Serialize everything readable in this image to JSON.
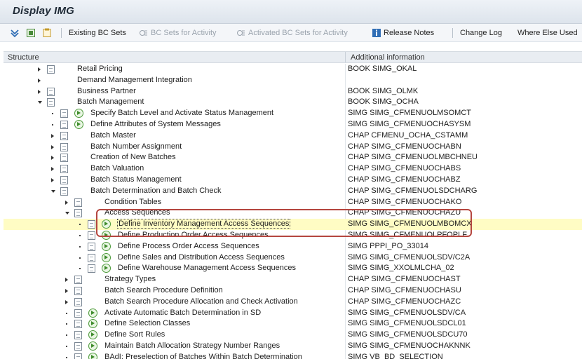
{
  "window": {
    "title": "Display IMG"
  },
  "toolbar": {
    "existing_bc_sets": "Existing BC Sets",
    "bc_sets_for_activity": "BC Sets for Activity",
    "activated_bc_sets_for_activity": "Activated BC Sets for Activity",
    "release_notes": "Release Notes",
    "change_log": "Change Log",
    "where_else_used": "Where Else Used"
  },
  "columns": {
    "structure": "Structure",
    "additional_info": "Additional information"
  },
  "rows": [
    {
      "label": "Retail Pricing",
      "info": "BOOK SIMG_OKAL"
    },
    {
      "label": "Demand Management Integration",
      "info": ""
    },
    {
      "label": "Business Partner",
      "info": "BOOK SIMG_OLMK"
    },
    {
      "label": "Batch Management",
      "info": "BOOK SIMG_OCHA"
    },
    {
      "label": "Specify Batch Level and Activate Status Management",
      "info": "SIMG SIMG_CFMENUOLMSOMCT"
    },
    {
      "label": "Define Attributes of System Messages",
      "info": "SIMG SIMG_CFMENUOCHASYSM"
    },
    {
      "label": "Batch Master",
      "info": "CHAP CFMENU_OCHA_CSTAMM"
    },
    {
      "label": "Batch Number Assignment",
      "info": "CHAP SIMG_CFMENUOCHABN"
    },
    {
      "label": "Creation of New Batches",
      "info": "CHAP SIMG_CFMENUOLMBCHNEU"
    },
    {
      "label": "Batch Valuation",
      "info": "CHAP SIMG_CFMENUOCHABS"
    },
    {
      "label": "Batch Status Management",
      "info": "CHAP SIMG_CFMENUOCHABZ"
    },
    {
      "label": "Batch Determination and Batch Check",
      "info": "CHAP SIMG_CFMENUOLSDCHARG"
    },
    {
      "label": "Condition Tables",
      "info": "CHAP SIMG_CFMENUOCHAKO"
    },
    {
      "label": "Access Sequences",
      "info": "CHAP SIMG_CFMENUOCHAZU"
    },
    {
      "label": "Define Inventory Management Access Sequences",
      "info": "SIMG SIMG_CFMENUOLMBOMCX"
    },
    {
      "label": "Define Production Order Access Sequences",
      "info": "SIMG SIMG_CFMENUOLPFOPLF"
    },
    {
      "label": "Define Process Order Access Sequences",
      "info": "SIMG PPPI_PO_33014"
    },
    {
      "label": "Define Sales and Distribution Access Sequences",
      "info": "SIMG SIMG_CFMENUOLSDV/C2A"
    },
    {
      "label": "Define Warehouse Management Access Sequences",
      "info": "SIMG SIMG_XXOLMLCHA_02"
    },
    {
      "label": "Strategy Types",
      "info": "CHAP SIMG_CFMENUOCHAST"
    },
    {
      "label": "Batch Search Procedure Definition",
      "info": "CHAP SIMG_CFMENUOCHASU"
    },
    {
      "label": "Batch Search Procedure Allocation and Check Activation",
      "info": "CHAP SIMG_CFMENUOCHAZC"
    },
    {
      "label": "Activate Automatic Batch Determination in SD",
      "info": "SIMG SIMG_CFMENUOLSDV/CA"
    },
    {
      "label": "Define Selection Classes",
      "info": "SIMG SIMG_CFMENUOLSDCL01"
    },
    {
      "label": "Define Sort Rules",
      "info": "SIMG SIMG_CFMENUOLSDCU70"
    },
    {
      "label": "Maintain Batch Allocation Strategy Number Ranges",
      "info": "SIMG SIMG_CFMENUOCHAKNNK"
    },
    {
      "label": "BAdI: Preselection of Batches Within Batch Determination",
      "info": "SIMG VB_BD_SELECTION"
    }
  ],
  "colors": {
    "highlight": "#fffcc4",
    "annotation": "#b5463f",
    "exec_icon": "#4d9a3a"
  }
}
